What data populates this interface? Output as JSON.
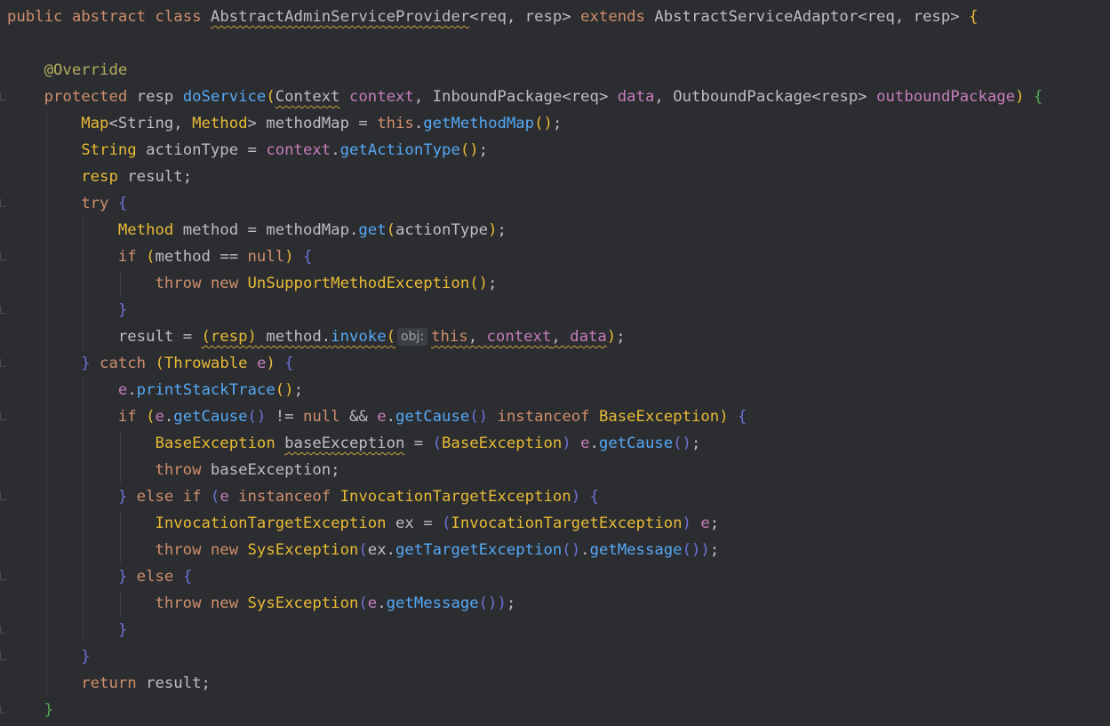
{
  "editor": {
    "lines": [
      [
        [
          "keyword",
          "public "
        ],
        [
          "keyword",
          "abstract "
        ],
        [
          "keyword",
          "class "
        ],
        [
          "class_wavy",
          "AbstractAdminServiceProvider"
        ],
        [
          "plain",
          "<req, resp> "
        ],
        [
          "keyword",
          "extends "
        ],
        [
          "class",
          "AbstractServiceAdaptor"
        ],
        [
          "plain",
          "<req, resp> "
        ],
        [
          "bracket",
          "{"
        ]
      ],
      [],
      [
        [
          "indent1",
          "    "
        ],
        [
          "annotation",
          "@Override"
        ]
      ],
      [
        [
          "indent1",
          "    "
        ],
        [
          "keyword",
          "protected "
        ],
        [
          "plain",
          "resp "
        ],
        [
          "method",
          "doService"
        ],
        [
          "bracket",
          "("
        ],
        [
          "class_wavy",
          "Context"
        ],
        [
          "plain",
          " "
        ],
        [
          "param",
          "context"
        ],
        [
          "plain",
          ", "
        ],
        [
          "class",
          "InboundPackage"
        ],
        [
          "plain",
          "<req> "
        ],
        [
          "param",
          "data"
        ],
        [
          "plain",
          ", "
        ],
        [
          "class",
          "OutboundPackage"
        ],
        [
          "plain",
          "<resp> "
        ],
        [
          "param",
          "outboundPackage"
        ],
        [
          "bracket",
          ")"
        ],
        [
          "plain",
          " "
        ],
        [
          "bracket2",
          "{"
        ]
      ],
      [
        [
          "indent2",
          "        "
        ],
        [
          "type",
          "Map"
        ],
        [
          "plain",
          "<String, "
        ],
        [
          "type",
          "Method"
        ],
        [
          "plain",
          "> methodMap = "
        ],
        [
          "keyword",
          "this"
        ],
        [
          "plain",
          "."
        ],
        [
          "method",
          "getMethodMap"
        ],
        [
          "bracket",
          "()"
        ],
        [
          "plain",
          ";"
        ]
      ],
      [
        [
          "indent2",
          "        "
        ],
        [
          "type",
          "String"
        ],
        [
          "plain",
          " actionType = "
        ],
        [
          "param",
          "context"
        ],
        [
          "plain",
          "."
        ],
        [
          "method",
          "getActionType"
        ],
        [
          "bracket",
          "()"
        ],
        [
          "plain",
          ";"
        ]
      ],
      [
        [
          "indent2",
          "        "
        ],
        [
          "type",
          "resp"
        ],
        [
          "plain",
          " result;"
        ]
      ],
      [
        [
          "indent2",
          "        "
        ],
        [
          "keyword",
          "try "
        ],
        [
          "bracket3",
          "{"
        ]
      ],
      [
        [
          "indent3",
          "            "
        ],
        [
          "type",
          "Method"
        ],
        [
          "plain",
          " method = methodMap."
        ],
        [
          "method",
          "get"
        ],
        [
          "bracket",
          "("
        ],
        [
          "plain",
          "actionType"
        ],
        [
          "bracket",
          ")"
        ],
        [
          "plain",
          ";"
        ]
      ],
      [
        [
          "indent3",
          "            "
        ],
        [
          "keyword",
          "if "
        ],
        [
          "bracket",
          "("
        ],
        [
          "plain",
          "method == "
        ],
        [
          "keyword",
          "null"
        ],
        [
          "bracket",
          ")"
        ],
        [
          "plain",
          " "
        ],
        [
          "bracket3",
          "{"
        ]
      ],
      [
        [
          "indent4",
          "                "
        ],
        [
          "keyword",
          "throw "
        ],
        [
          "keyword",
          "new "
        ],
        [
          "type",
          "UnSupportMethodException"
        ],
        [
          "bracket",
          "()"
        ],
        [
          "plain",
          ";"
        ]
      ],
      [
        [
          "indent3",
          "            "
        ],
        [
          "bracket3",
          "}"
        ]
      ],
      [
        [
          "indent3",
          "            "
        ],
        [
          "plain",
          "result = "
        ],
        [
          "cast_wavy",
          "(resp)"
        ],
        [
          "plain_wavy",
          " method."
        ],
        [
          "method_wavy",
          "invoke"
        ],
        [
          "bracket_wavy",
          "("
        ],
        [
          "hint",
          "obj:"
        ],
        [
          "keyword_wavy",
          "this"
        ],
        [
          "plain_wavy",
          ", "
        ],
        [
          "param_wavy",
          "context"
        ],
        [
          "plain_wavy",
          ", "
        ],
        [
          "param_wavy",
          "data"
        ],
        [
          "bracket",
          ")"
        ],
        [
          "plain",
          ";"
        ]
      ],
      [
        [
          "indent2",
          "        "
        ],
        [
          "bracket3",
          "}"
        ],
        [
          "plain",
          " "
        ],
        [
          "keyword",
          "catch "
        ],
        [
          "bracket",
          "("
        ],
        [
          "type",
          "Throwable"
        ],
        [
          "plain",
          " "
        ],
        [
          "param",
          "e"
        ],
        [
          "bracket",
          ")"
        ],
        [
          "plain",
          " "
        ],
        [
          "bracket3",
          "{"
        ]
      ],
      [
        [
          "indent3",
          "            "
        ],
        [
          "param",
          "e"
        ],
        [
          "plain",
          "."
        ],
        [
          "method",
          "printStackTrace"
        ],
        [
          "bracket",
          "()"
        ],
        [
          "plain",
          ";"
        ]
      ],
      [
        [
          "indent3",
          "            "
        ],
        [
          "keyword",
          "if "
        ],
        [
          "bracket",
          "("
        ],
        [
          "param",
          "e"
        ],
        [
          "plain",
          "."
        ],
        [
          "method",
          "getCause"
        ],
        [
          "bracket3",
          "()"
        ],
        [
          "plain",
          " != "
        ],
        [
          "keyword",
          "null"
        ],
        [
          "plain",
          " && "
        ],
        [
          "param",
          "e"
        ],
        [
          "plain",
          "."
        ],
        [
          "method",
          "getCause"
        ],
        [
          "bracket3",
          "()"
        ],
        [
          "plain",
          " "
        ],
        [
          "keyword",
          "instanceof "
        ],
        [
          "type",
          "BaseException"
        ],
        [
          "bracket",
          ")"
        ],
        [
          "plain",
          " "
        ],
        [
          "bracket3",
          "{"
        ]
      ],
      [
        [
          "indent4",
          "                "
        ],
        [
          "type",
          "BaseException"
        ],
        [
          "plain",
          " "
        ],
        [
          "plain_wavy",
          "baseException"
        ],
        [
          "plain",
          " = "
        ],
        [
          "bracket3",
          "("
        ],
        [
          "type",
          "BaseException"
        ],
        [
          "bracket3",
          ")"
        ],
        [
          "plain",
          " "
        ],
        [
          "param",
          "e"
        ],
        [
          "plain",
          "."
        ],
        [
          "method",
          "getCause"
        ],
        [
          "bracket3",
          "()"
        ],
        [
          "plain",
          ";"
        ]
      ],
      [
        [
          "indent4",
          "                "
        ],
        [
          "keyword",
          "throw "
        ],
        [
          "plain",
          "baseException;"
        ]
      ],
      [
        [
          "indent3",
          "            "
        ],
        [
          "bracket3",
          "}"
        ],
        [
          "plain",
          " "
        ],
        [
          "keyword",
          "else if "
        ],
        [
          "bracket3",
          "("
        ],
        [
          "param",
          "e"
        ],
        [
          "plain",
          " "
        ],
        [
          "keyword",
          "instanceof "
        ],
        [
          "type",
          "InvocationTargetException"
        ],
        [
          "bracket3",
          ")"
        ],
        [
          "plain",
          " "
        ],
        [
          "bracket3",
          "{"
        ]
      ],
      [
        [
          "indent4",
          "                "
        ],
        [
          "type",
          "InvocationTargetException"
        ],
        [
          "plain",
          " ex = "
        ],
        [
          "bracket3",
          "("
        ],
        [
          "type",
          "InvocationTargetException"
        ],
        [
          "bracket3",
          ")"
        ],
        [
          "plain",
          " "
        ],
        [
          "param",
          "e"
        ],
        [
          "plain",
          ";"
        ]
      ],
      [
        [
          "indent4",
          "                "
        ],
        [
          "keyword",
          "throw "
        ],
        [
          "keyword",
          "new "
        ],
        [
          "type",
          "SysException"
        ],
        [
          "bracket3",
          "("
        ],
        [
          "plain",
          "ex."
        ],
        [
          "method",
          "getTargetException"
        ],
        [
          "bracket3",
          "()"
        ],
        [
          "plain",
          "."
        ],
        [
          "method",
          "getMessage"
        ],
        [
          "bracket3",
          "()"
        ],
        [
          "bracket3",
          ")"
        ],
        [
          "plain",
          ";"
        ]
      ],
      [
        [
          "indent3",
          "            "
        ],
        [
          "bracket3",
          "}"
        ],
        [
          "plain",
          " "
        ],
        [
          "keyword",
          "else "
        ],
        [
          "bracket3",
          "{"
        ]
      ],
      [
        [
          "indent4",
          "                "
        ],
        [
          "keyword",
          "throw "
        ],
        [
          "keyword",
          "new "
        ],
        [
          "type",
          "SysException"
        ],
        [
          "bracket3",
          "("
        ],
        [
          "param",
          "e"
        ],
        [
          "plain",
          "."
        ],
        [
          "method",
          "getMessage"
        ],
        [
          "bracket3",
          "()"
        ],
        [
          "bracket3",
          ")"
        ],
        [
          "plain",
          ";"
        ]
      ],
      [
        [
          "indent3",
          "            "
        ],
        [
          "bracket3",
          "}"
        ]
      ],
      [
        [
          "indent2",
          "        "
        ],
        [
          "bracket3",
          "}"
        ]
      ],
      [
        [
          "indent2",
          "        "
        ],
        [
          "keyword",
          "return "
        ],
        [
          "plain",
          "result;"
        ]
      ],
      [
        [
          "indent1",
          "    "
        ],
        [
          "bracket2",
          "}"
        ]
      ]
    ]
  }
}
